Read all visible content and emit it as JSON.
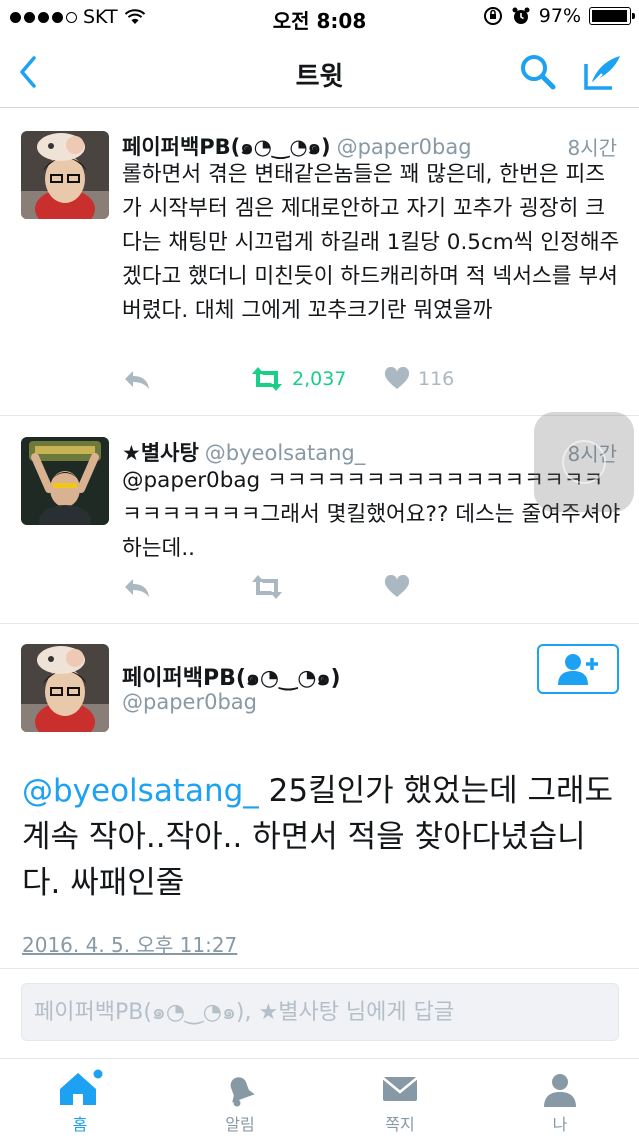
{
  "status": {
    "carrier": "SKT",
    "time": "오전 8:08",
    "battery": "97%",
    "battery_level": 0.97
  },
  "nav": {
    "title": "트윗"
  },
  "tweets": [
    {
      "name": "페이퍼백PB(๑◔‿◔๑)",
      "handle": "@paper0bag",
      "time": "8시간",
      "text": "롤하면서 겪은 변태같은놈들은 꽤 많은데, 한번은 피즈가 시작부터 겜은 제대로안하고 자기 꼬추가 굉장히 크다는 채팅만 시끄럽게 하길래 1킬당 0.5cm씩 인정해주겠다고 했더니 미친듯이 하드캐리하며 적 넥서스를 부셔버렸다. 대체 그에게 꼬추크기란 뭐였을까",
      "retweets": "2,037",
      "likes": "116"
    },
    {
      "name": "★별사탕",
      "handle": "@byeolsatang_",
      "time": "8시간",
      "text": "@paper0bag ㅋㅋㅋㅋㅋㅋㅋㅋㅋㅋㅋㅋㅋㅋㅋㅋㅋㅋㅋㅋㅋㅋㅋㅋ그래서 몇킬했어요?? 데스는 줄여주셔야하는데..",
      "retweets": "",
      "likes": ""
    }
  ],
  "main_tweet": {
    "name": "페이퍼백PB(๑◔‿◔๑)",
    "handle": "@paper0bag",
    "mention": "@byeolsatang_",
    "text": " 25킬인가 했었는데 그래도 계속 작아..작아.. 하면서 적을 찾아다녔습니다. 싸패인줄",
    "date": "2016. 4. 5. 오후 11:27"
  },
  "reply": {
    "placeholder": "페이퍼백PB(๑◔‿◔๑), ★별사탕 님에게 답글"
  },
  "tabs": [
    {
      "label": "홈",
      "icon": "home-icon"
    },
    {
      "label": "알림",
      "icon": "bell-icon"
    },
    {
      "label": "쪽지",
      "icon": "envelope-icon"
    },
    {
      "label": "나",
      "icon": "person-icon"
    }
  ],
  "colors": {
    "accent": "#1da1f2",
    "retweet_active": "#19cf86",
    "muted": "#8899a6"
  }
}
